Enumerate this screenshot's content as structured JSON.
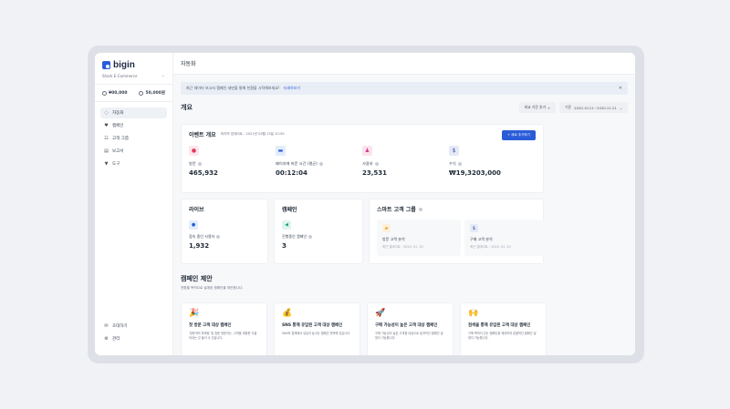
{
  "app": {
    "logo_text": "bigin",
    "brand": "Shark E-Commerce"
  },
  "credits": [
    {
      "value": "¥00,000"
    },
    {
      "value": "50,000원"
    }
  ],
  "sidebar": {
    "items": [
      {
        "label": "자동화",
        "icon": "automation-icon"
      },
      {
        "label": "캠페인",
        "icon": "heart-icon"
      },
      {
        "label": "고객 그룹",
        "icon": "people-icon"
      },
      {
        "label": "보고서",
        "icon": "report-icon"
      },
      {
        "label": "도구",
        "icon": "filter-icon"
      }
    ],
    "bottom": [
      {
        "label": "초대하기",
        "icon": "invite-icon"
      },
      {
        "label": "관리",
        "icon": "settings-icon"
      }
    ]
  },
  "header": {
    "title": "자동화"
  },
  "banner": {
    "text": "최근 데이터 보고서 캠페인 세만을 통해 친환을 시작해보세요!",
    "link": "자세히보기"
  },
  "overview": {
    "title": "개요",
    "compare_label": "비교 기간 추가",
    "date_label": "기준",
    "date_range": "2020.10.21~2020.11.21"
  },
  "event": {
    "title": "이벤트 개요",
    "updated": "마지막 업데이트 : 2021년 03월 13일 10:30",
    "add_button": "+ 새로 추가하기",
    "metrics": [
      {
        "label": "방문",
        "value": "465,932",
        "color": "#fde7ec",
        "fg": "#e2385f",
        "icon": "drop-icon"
      },
      {
        "label": "페이지에 머문 시간 (평균)",
        "value": "00:12:04",
        "color": "#e3ecfb",
        "fg": "#2b5cd8",
        "icon": "window-icon"
      },
      {
        "label": "사용자",
        "value": "23,531",
        "color": "#fbe3ef",
        "fg": "#d03a86",
        "icon": "user-icon"
      },
      {
        "label": "수익",
        "value": "₩19,3203,000",
        "color": "#e5e9f7",
        "fg": "#2e4aa8",
        "icon": "money-bag-icon"
      }
    ]
  },
  "live": {
    "title": "라이브",
    "label": "접속 중인 사용자",
    "value": "1,932"
  },
  "campaign_box": {
    "title": "캠페인",
    "label": "진행중인 캠페인",
    "value": "3"
  },
  "smart": {
    "title": "스마트 고객 그룹",
    "groups": [
      {
        "name": "방문 고객 분석",
        "date": "최근 업데이트 : 2020. 01. 20",
        "color": "#fdf0d9"
      },
      {
        "name": "구매 고객 분석",
        "date": "최근 업데이트 : 2020. 01. 20",
        "color": "#e5e9f7"
      }
    ]
  },
  "campaign_suggest": {
    "title": "캠페인 제안",
    "subtitle": "전환을 목적으로 설계된 캠페인을 제안합니다.",
    "cards": [
      {
        "icon": "🎉",
        "title": "첫 방문 고객 대상 캠페인",
        "desc": "'방문객의 마케팅' 및 방문 방문자는, 고객을 재방문 이끌어내는 것 들이 수 있습니다."
      },
      {
        "icon": "💰",
        "title": "SNS 통해 유입된 고객 대상 캠페인",
        "desc": "SNS와 접채에서 유입이 높고는 캠페인 전략에 있습니다."
      },
      {
        "icon": "🚀",
        "title": "구매 가능성이 높은 고객 대상 캠페인",
        "desc": "구매 가능성이 높은 고객을 대상으로 효과적인 캠페인 설정이 가능합니다."
      },
      {
        "icon": "🙌",
        "title": "검색을 통해 유입된 고객 대상 캠페인",
        "desc": "구매 목적이 있는 캠페인을 제공하여 효율적인 캠페인 설정이 가능합니다."
      }
    ]
  }
}
